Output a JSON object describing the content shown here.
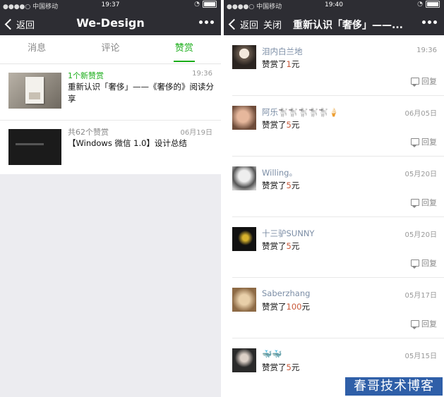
{
  "left": {
    "status": {
      "carrier": "●●●●○ 中国移动",
      "time": "19:37"
    },
    "nav": {
      "back_label": "返回",
      "title": "We-Design"
    },
    "tabs": [
      {
        "label": "消息"
      },
      {
        "label": "评论"
      },
      {
        "label": "赞赏"
      }
    ],
    "messages": [
      {
        "summary": "1个新赞赏",
        "time": "19:36",
        "text": "重新认识「奢侈」——《奢侈的》阅读分享"
      },
      {
        "summary": "共62个赞赏",
        "time": "06月19日",
        "text": "【Windows 微信 1.0】设计总结"
      }
    ]
  },
  "right": {
    "status": {
      "carrier": "●●●●○ 中国移动",
      "time": "19:40"
    },
    "nav": {
      "back_label": "返回",
      "close_label": "关闭",
      "title": "重新认识「奢侈」——..."
    },
    "reply_label": "回复",
    "rewards": [
      {
        "name": "泪内白兰地",
        "time": "19:36",
        "prefix": "赞赏了",
        "amount": "1",
        "unit": "元"
      },
      {
        "name": "阿乐🐩🐩🐩🐩🐩🍦",
        "time": "06月05日",
        "prefix": "赞赏了",
        "amount": "5",
        "unit": "元"
      },
      {
        "name": "Willing。",
        "time": "05月20日",
        "prefix": "赞赏了",
        "amount": "5",
        "unit": "元"
      },
      {
        "name": "十三驴SUNNY",
        "time": "05月20日",
        "prefix": "赞赏了",
        "amount": "5",
        "unit": "元"
      },
      {
        "name": "Saberzhang",
        "time": "05月17日",
        "prefix": "赞赏了",
        "amount": "100",
        "unit": "元"
      },
      {
        "name": "🐳🐳",
        "time": "05月15日",
        "prefix": "赞赏了",
        "amount": "5",
        "unit": "元"
      }
    ]
  },
  "watermark": "春哥技术博客"
}
